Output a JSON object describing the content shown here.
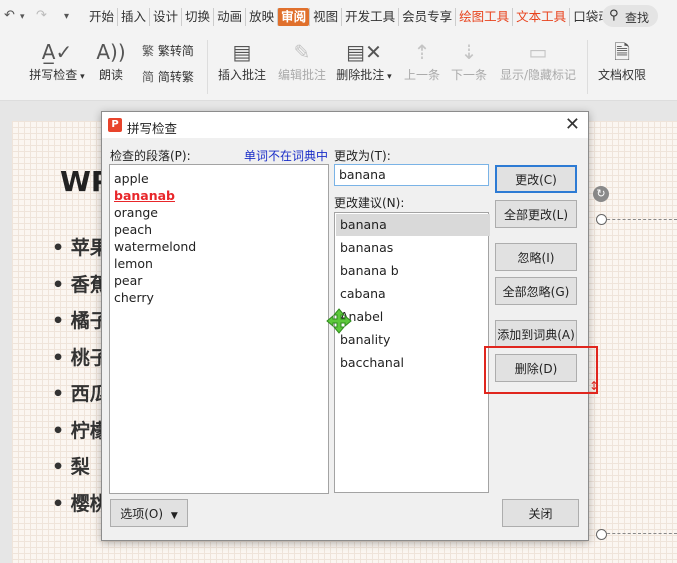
{
  "menubar": {
    "undo_icon": "undo-icon",
    "redo_icon": "redo-icon",
    "tabs": [
      {
        "label": "开始",
        "style": "normal"
      },
      {
        "label": "插入",
        "style": "normal"
      },
      {
        "label": "设计",
        "style": "normal"
      },
      {
        "label": "切换",
        "style": "normal"
      },
      {
        "label": "动画",
        "style": "normal"
      },
      {
        "label": "放映",
        "style": "normal"
      },
      {
        "label": "审阅",
        "style": "active"
      },
      {
        "label": "视图",
        "style": "normal"
      },
      {
        "label": "开发工具",
        "style": "normal"
      },
      {
        "label": "会员专享",
        "style": "normal"
      },
      {
        "label": "绘图工具",
        "style": "orange"
      },
      {
        "label": "文本工具",
        "style": "orange"
      },
      {
        "label": "口袋动",
        "style": "normal"
      }
    ],
    "search_label": "查找"
  },
  "ribbon": {
    "spell_check": "拼写检查",
    "read_aloud": "朗读",
    "trad_to_simp": "繁转简",
    "simp_to_trad": "简转繁",
    "insert_comment": "插入批注",
    "edit_comment": "编辑批注",
    "delete_comment": "删除批注",
    "prev": "上一条",
    "next": "下一条",
    "show_hide_marks": "显示/隐藏标记",
    "doc_permission": "文档权限"
  },
  "slide": {
    "title": "WP",
    "bullets": [
      "苹果",
      "香蕉",
      "橘子",
      "桃子",
      "西瓜",
      "柠檬",
      "梨",
      "樱桃"
    ]
  },
  "dialog": {
    "title": "拼写检查",
    "paragraph_label": "检查的段落(P):",
    "not_in_dict_label": "单词不在词典中",
    "change_to_label": "更改为(T):",
    "change_to_value": "banana",
    "suggestions_label": "更改建议(N):",
    "paragraph_words": [
      "apple",
      "bananab",
      "orange",
      "peach",
      "watermelond",
      "lemon",
      "pear",
      "cherry"
    ],
    "error_word_index": 1,
    "suggestions": [
      "banana",
      "bananas",
      "banana b",
      "cabana",
      "Anabel",
      "banality",
      "bacchanal"
    ],
    "selected_suggestion_index": 0,
    "buttons": {
      "change": "更改(C)",
      "change_all": "全部更改(L)",
      "ignore": "忽略(I)",
      "ignore_all": "全部忽略(G)",
      "add_to_dict": "添加到词典(A)",
      "delete": "删除(D)",
      "options": "选项(O)",
      "close": "关闭"
    }
  },
  "colors": {
    "accent_tab": "#e0702c",
    "error_word": "#e8262a",
    "label_blue": "#1a2ec8",
    "highlight_box": "#e0261e",
    "focus_border": "#2d7bd4"
  }
}
